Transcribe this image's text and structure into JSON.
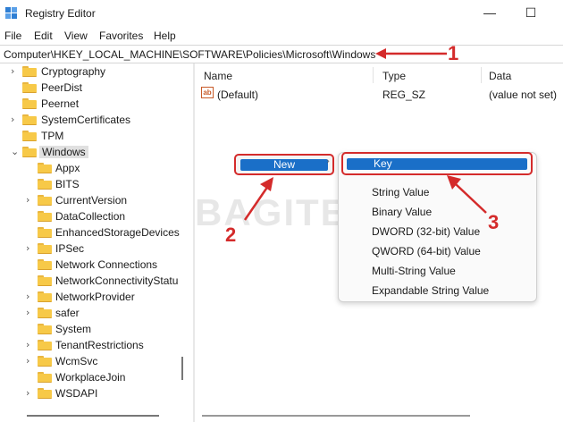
{
  "window": {
    "title": "Registry Editor",
    "minimize_glyph": "—",
    "maximize_glyph": "☐",
    "app_icon": "registry-icon"
  },
  "menu": {
    "items": [
      "File",
      "Edit",
      "View",
      "Favorites",
      "Help"
    ]
  },
  "address": {
    "path": "Computer\\HKEY_LOCAL_MACHINE\\SOFTWARE\\Policies\\Microsoft\\Windows"
  },
  "tree": {
    "items": [
      {
        "label": "Cryptography",
        "expander": ">"
      },
      {
        "label": "PeerDist",
        "expander": ""
      },
      {
        "label": "Peernet",
        "expander": ""
      },
      {
        "label": "SystemCertificates",
        "expander": ">"
      },
      {
        "label": "TPM",
        "expander": ""
      },
      {
        "label": "Windows",
        "expander": "v",
        "selected": true
      },
      {
        "label": "Appx",
        "expander": ""
      },
      {
        "label": "BITS",
        "expander": ""
      },
      {
        "label": "CurrentVersion",
        "expander": ">"
      },
      {
        "label": "DataCollection",
        "expander": ""
      },
      {
        "label": "EnhancedStorageDevices",
        "expander": ""
      },
      {
        "label": "IPSec",
        "expander": ">"
      },
      {
        "label": "Network Connections",
        "expander": ""
      },
      {
        "label": "NetworkConnectivityStatu",
        "expander": ""
      },
      {
        "label": "NetworkProvider",
        "expander": ">"
      },
      {
        "label": "safer",
        "expander": ">"
      },
      {
        "label": "System",
        "expander": ""
      },
      {
        "label": "TenantRestrictions",
        "expander": ">"
      },
      {
        "label": "WcmSvc",
        "expander": ">"
      },
      {
        "label": "WorkplaceJoin",
        "expander": ""
      },
      {
        "label": "WSDAPI",
        "expander": ">"
      }
    ]
  },
  "list": {
    "columns": {
      "name": "Name",
      "type": "Type",
      "data": "Data"
    },
    "rows": [
      {
        "name": "(Default)",
        "type": "REG_SZ",
        "data": "(value not set)",
        "icon": "ab"
      }
    ]
  },
  "context_menu": {
    "new_label": "New",
    "new_arrow": "›",
    "submenu": [
      "Key",
      "String Value",
      "Binary Value",
      "DWORD (32-bit) Value",
      "QWORD (64-bit) Value",
      "Multi-String Value",
      "Expandable String Value"
    ]
  },
  "watermark": {
    "text": "BAGITEKNO"
  },
  "annotations": {
    "step1": "1",
    "step2": "2",
    "step3": "3"
  },
  "colors": {
    "highlight": "#1a6fc8",
    "annotation_red": "#d42b2b",
    "folder": "#f7c948"
  }
}
